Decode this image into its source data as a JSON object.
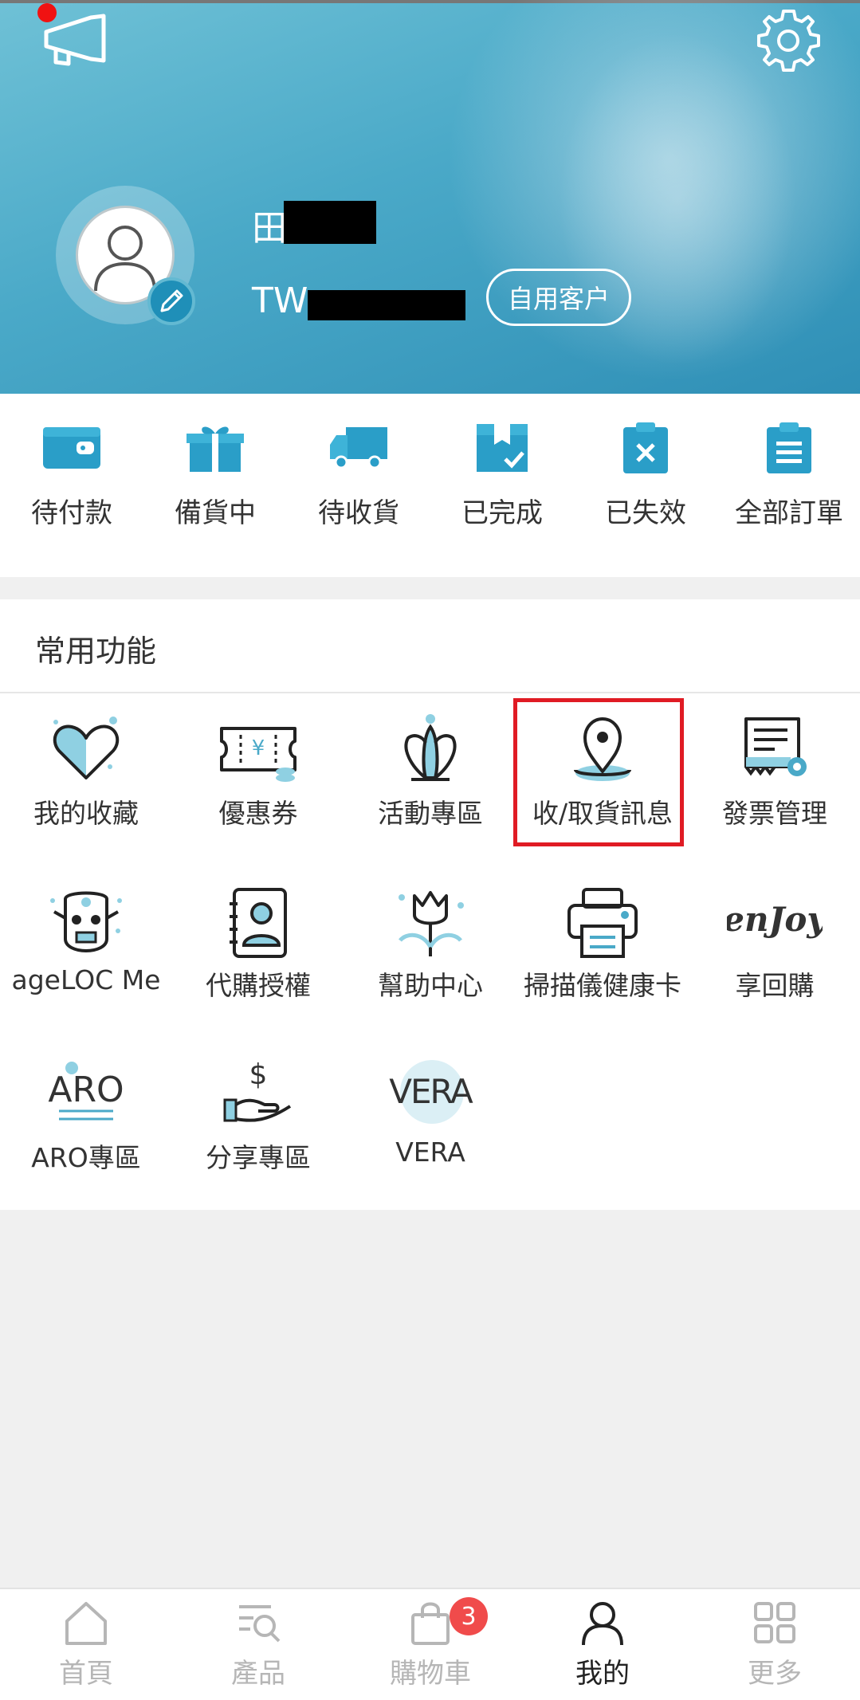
{
  "header": {
    "name_visible": "田",
    "member_id_visible": "TW",
    "customer_type": "自用客户"
  },
  "orders": [
    {
      "label": "待付款",
      "icon": "wallet-icon"
    },
    {
      "label": "備貨中",
      "icon": "gift-box-icon"
    },
    {
      "label": "待收貨",
      "icon": "delivery-truck-icon"
    },
    {
      "label": "已完成",
      "icon": "box-check-icon"
    },
    {
      "label": "已失效",
      "icon": "clipboard-x-icon"
    },
    {
      "label": "全部訂單",
      "icon": "clipboard-list-icon"
    }
  ],
  "functions": {
    "title": "常用功能",
    "items": [
      {
        "label": "我的收藏",
        "icon": "heart-icon"
      },
      {
        "label": "優惠券",
        "icon": "coupon-icon"
      },
      {
        "label": "活動專區",
        "icon": "crown-icon"
      },
      {
        "label": "收/取貨訊息",
        "icon": "location-pin-icon",
        "highlighted": true
      },
      {
        "label": "發票管理",
        "icon": "invoice-gear-icon"
      },
      {
        "label": "ageLOC Me",
        "icon": "agent-face-icon"
      },
      {
        "label": "代購授權",
        "icon": "contact-book-icon"
      },
      {
        "label": "幫助中心",
        "icon": "tulip-icon"
      },
      {
        "label": "掃描儀健康卡",
        "icon": "printer-icon"
      },
      {
        "label": "享回購",
        "icon": "enjoy-logo-icon"
      },
      {
        "label": "ARO專區",
        "icon": "aro-logo-icon"
      },
      {
        "label": "分享專區",
        "icon": "hand-dollar-icon"
      },
      {
        "label": "VERA",
        "icon": "vera-logo-icon"
      }
    ]
  },
  "logos": {
    "enjoy": "enJoy",
    "aro": "ARO",
    "vera": "VERA"
  },
  "tabbar": {
    "items": [
      {
        "label": "首頁",
        "icon": "home-icon"
      },
      {
        "label": "產品",
        "icon": "product-search-icon"
      },
      {
        "label": "購物車",
        "icon": "shopping-bag-icon"
      },
      {
        "label": "我的",
        "icon": "user-icon",
        "active": true
      },
      {
        "label": "更多",
        "icon": "grid-icon"
      }
    ],
    "cart_count": "3"
  },
  "colors": {
    "accent": "#2a9ec8",
    "accent_light": "#8fd0e2",
    "highlight": "#e01b24",
    "badge": "#f04b4b"
  }
}
